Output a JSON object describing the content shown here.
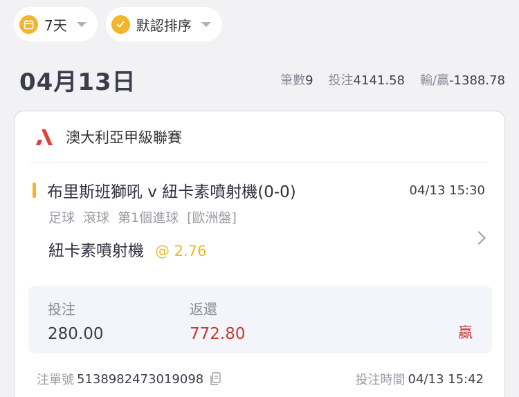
{
  "filters": {
    "period": {
      "label": "7天",
      "icon": "calendar-icon"
    },
    "sort": {
      "label": "默認排序",
      "icon": "check-icon"
    }
  },
  "day": {
    "date": "04月13日",
    "count_label": "筆數",
    "count_value": "9",
    "stake_label": "投注",
    "stake_value": "4141.58",
    "pnl_label": "輸/贏",
    "pnl_value": "-1388.78"
  },
  "bet": {
    "league": "澳大利亞甲級聯賽",
    "match_title": "布里斯班獅吼 v 紐卡素噴射機(0-0)",
    "match_time": "04/13 15:30",
    "sport": "足球",
    "market_type": "滾球",
    "market": "第1個進球",
    "odds_type": "[歐洲盤]",
    "pick": "紐卡素噴射機",
    "odds": "@ 2.76",
    "stake_label": "投注",
    "stake": "280.00",
    "return_label": "返還",
    "return_value": "772.80",
    "result": "贏",
    "ticket_label": "注單號",
    "ticket_no": "5138982473019098",
    "bet_time_label": "投注時間",
    "bet_time": "04/13 15:42"
  },
  "colors": {
    "accent": "#f4b52c",
    "win": "#c93a34",
    "league_logo": "#e0413a"
  }
}
